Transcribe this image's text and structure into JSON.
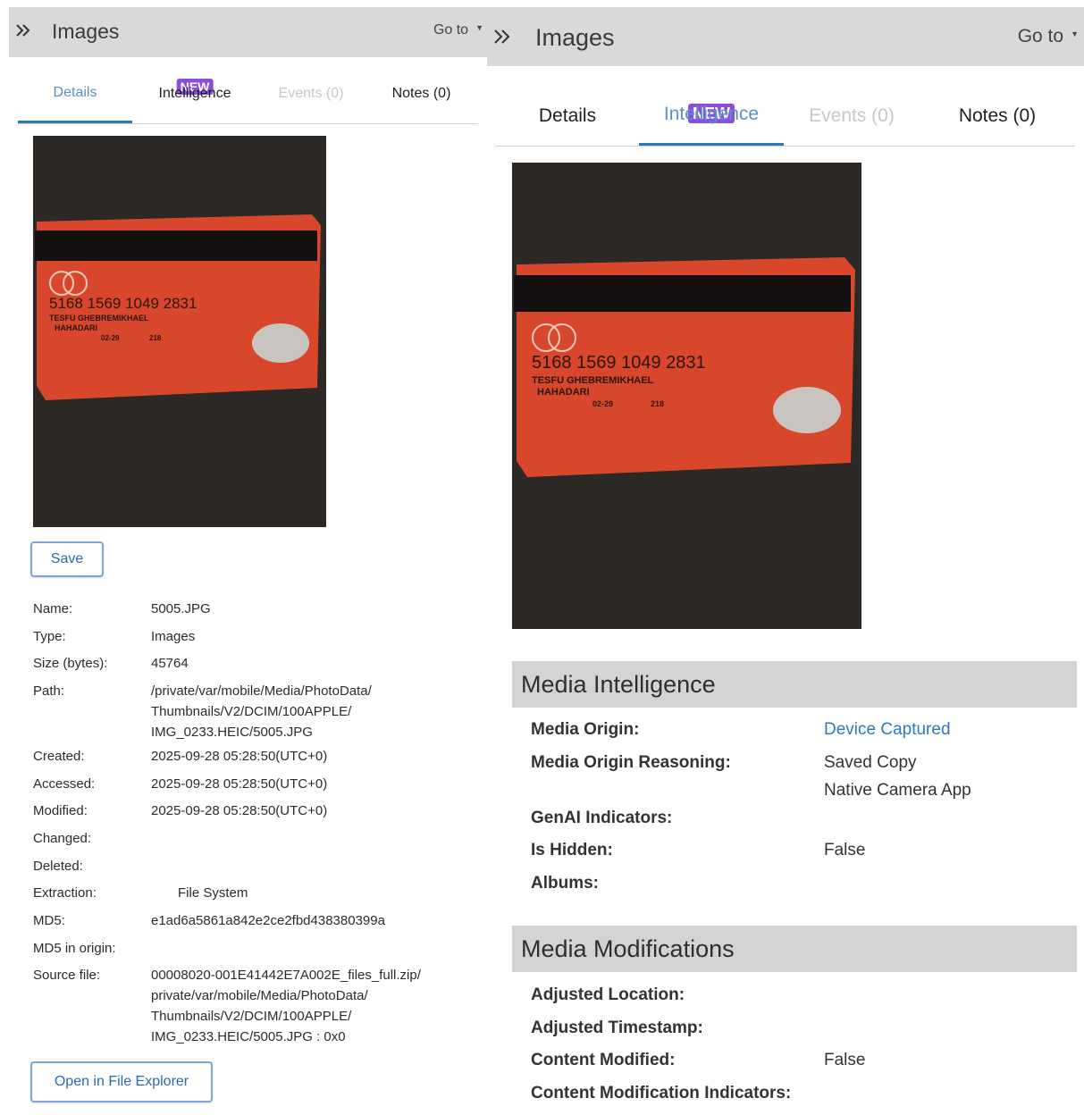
{
  "left": {
    "title": "Images",
    "goto": "Go to",
    "tabs": [
      {
        "label": "Details"
      },
      {
        "label": "Intelligence",
        "badge": "NEW"
      },
      {
        "label": "Events (0)"
      },
      {
        "label": "Notes (0)"
      }
    ],
    "save_label": "Save",
    "open_label": "Open in File Explorer",
    "properties": [
      {
        "label": "Name:",
        "value": "5005.JPG"
      },
      {
        "label": "Type:",
        "value": "Images"
      },
      {
        "label": "Size (bytes):",
        "value": "45764"
      },
      {
        "label": "Path:",
        "value": "/private/var/mobile/Media/PhotoData/\nThumbnails/V2/DCIM/100APPLE/\nIMG_0233.HEIC/5005.JPG"
      },
      {
        "label": "Created:",
        "value": "2025-09-28 05:28:50(UTC+0)"
      },
      {
        "label": "Accessed:",
        "value": "2025-09-28 05:28:50(UTC+0)"
      },
      {
        "label": "Modified:",
        "value": "2025-09-28 05:28:50(UTC+0)"
      },
      {
        "label": "Changed:",
        "value": ""
      },
      {
        "label": "Deleted:",
        "value": ""
      },
      {
        "label": "Extraction:",
        "value": "File System"
      },
      {
        "label": "MD5:",
        "value": "e1ad6a5861a842e2ce2fbd438380399a"
      },
      {
        "label": "MD5 in origin:",
        "value": ""
      },
      {
        "label": "Source file:",
        "value": "00008020-001E41442E7A002E_files_full.zip/\nprivate/var/mobile/Media/PhotoData/\nThumbnails/V2/DCIM/100APPLE/\nIMG_0233.HEIC/5005.JPG : 0x0"
      }
    ]
  },
  "right": {
    "title": "Images",
    "goto": "Go to",
    "tabs": [
      {
        "label": "Details"
      },
      {
        "label": "Intelligence",
        "badge": "NEW"
      },
      {
        "label": "Events (0)"
      },
      {
        "label": "Notes (0)"
      }
    ],
    "media_intelligence": {
      "header": "Media Intelligence",
      "rows": [
        {
          "label": "Media Origin:",
          "value": "Device Captured"
        },
        {
          "label": "Media Origin Reasoning:",
          "value": "Saved Copy\nNative Camera App"
        },
        {
          "label": "GenAI Indicators:",
          "value": ""
        },
        {
          "label": "Is Hidden:",
          "value": "False"
        },
        {
          "label": "Albums:",
          "value": ""
        }
      ]
    },
    "media_modifications": {
      "header": "Media Modifications",
      "rows": [
        {
          "label": "Adjusted Location:",
          "value": ""
        },
        {
          "label": "Adjusted Timestamp:",
          "value": ""
        },
        {
          "label": "Content Modified:",
          "value": "False"
        },
        {
          "label": "Content Modification Indicators:",
          "value": ""
        }
      ]
    }
  },
  "photo_card": {
    "number": "5168 1569 1049 2831",
    "holder_line1": "TESFU GHEBREMIKHAEL",
    "holder_line2": "HAHADARI",
    "expiry": "02-29",
    "cvv": "218"
  },
  "colors": {
    "accent": "#2b7bb9",
    "badge": "#8b4fe0",
    "link": "#2f76c5",
    "card": "#e04a2b"
  }
}
